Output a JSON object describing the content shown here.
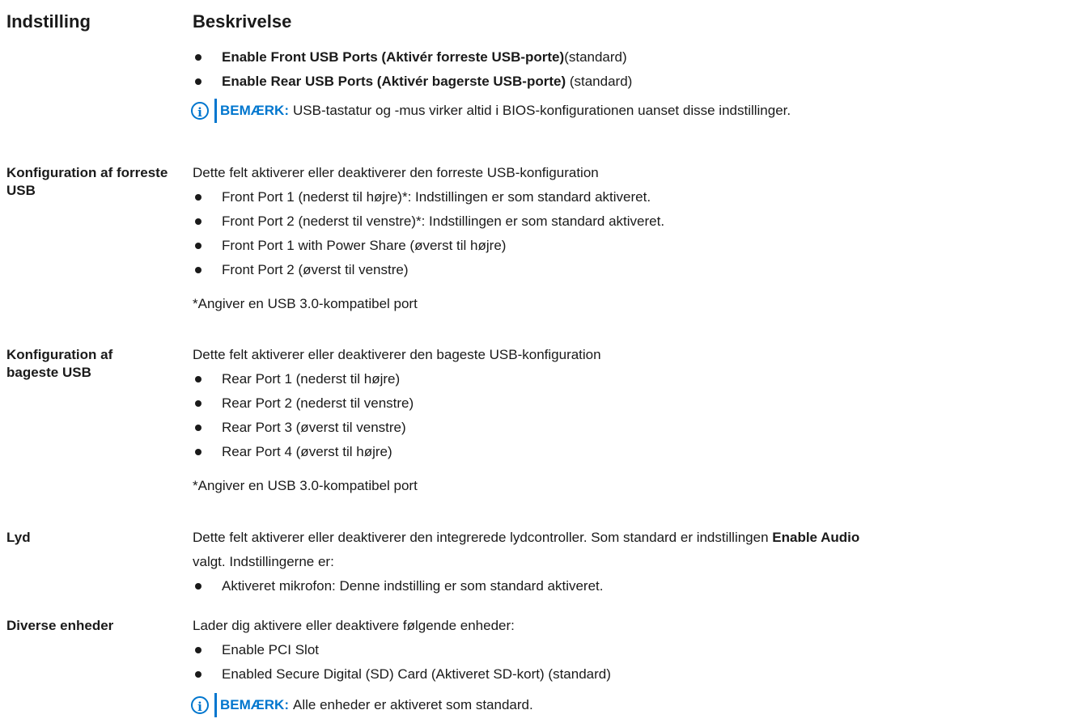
{
  "header": {
    "setting": "Indstilling",
    "description": "Beskrivelse"
  },
  "usb_ports": {
    "items": [
      {
        "bold": "Enable Front USB Ports (Aktivér forreste USB-porte)",
        "text": "(standard)"
      },
      {
        "bold": "Enable Rear USB Ports (Aktivér bagerste USB-porte)",
        "text": " (standard)"
      }
    ],
    "note_label": "BEMÆRK:",
    "note_text": "USB-tastatur og -mus virker altid i BIOS-konfigurationen uanset disse indstillinger."
  },
  "front_usb": {
    "label": "Konfiguration af forreste USB",
    "intro": "Dette felt aktiverer eller deaktiverer den forreste USB-konfiguration",
    "items": [
      "Front Port 1 (nederst til højre)*: Indstillingen er som standard aktiveret.",
      "Front Port 2 (nederst til venstre)*: Indstillingen er som standard aktiveret.",
      "Front Port 1 with Power Share (øverst til højre)",
      "Front Port 2 (øverst til venstre)"
    ],
    "footnote": "*Angiver en USB 3.0-kompatibel port"
  },
  "rear_usb": {
    "label": "Konfiguration af bageste USB",
    "intro": "Dette felt aktiverer eller deaktiverer den bageste USB-konfiguration",
    "items": [
      "Rear Port 1 (nederst til højre)",
      "Rear Port 2 (nederst til venstre)",
      "Rear Port 3 (øverst til venstre)",
      "Rear Port 4 (øverst til højre)"
    ],
    "footnote": "*Angiver en USB 3.0-kompatibel port"
  },
  "audio": {
    "label": "Lyd",
    "intro_pre": "Dette felt aktiverer eller deaktiverer den integrerede lydcontroller. Som standard er indstillingen ",
    "intro_bold": "Enable Audio",
    "intro_line2": "valgt. Indstillingerne er:",
    "items": [
      "Aktiveret mikrofon: Denne indstilling er som standard aktiveret."
    ]
  },
  "misc": {
    "label": "Diverse enheder",
    "intro": "Lader dig aktivere eller deaktivere følgende enheder:",
    "items": [
      "Enable PCI Slot",
      "Enabled Secure Digital (SD) Card (Aktiveret SD-kort) (standard)"
    ],
    "note_label": "BEMÆRK:",
    "note_text": "Alle enheder er aktiveret som standard."
  },
  "colors": {
    "accent": "#0076ce",
    "text": "#1a1a1a"
  },
  "icons": {
    "note": "info-icon",
    "bullet": "bullet-dot"
  }
}
